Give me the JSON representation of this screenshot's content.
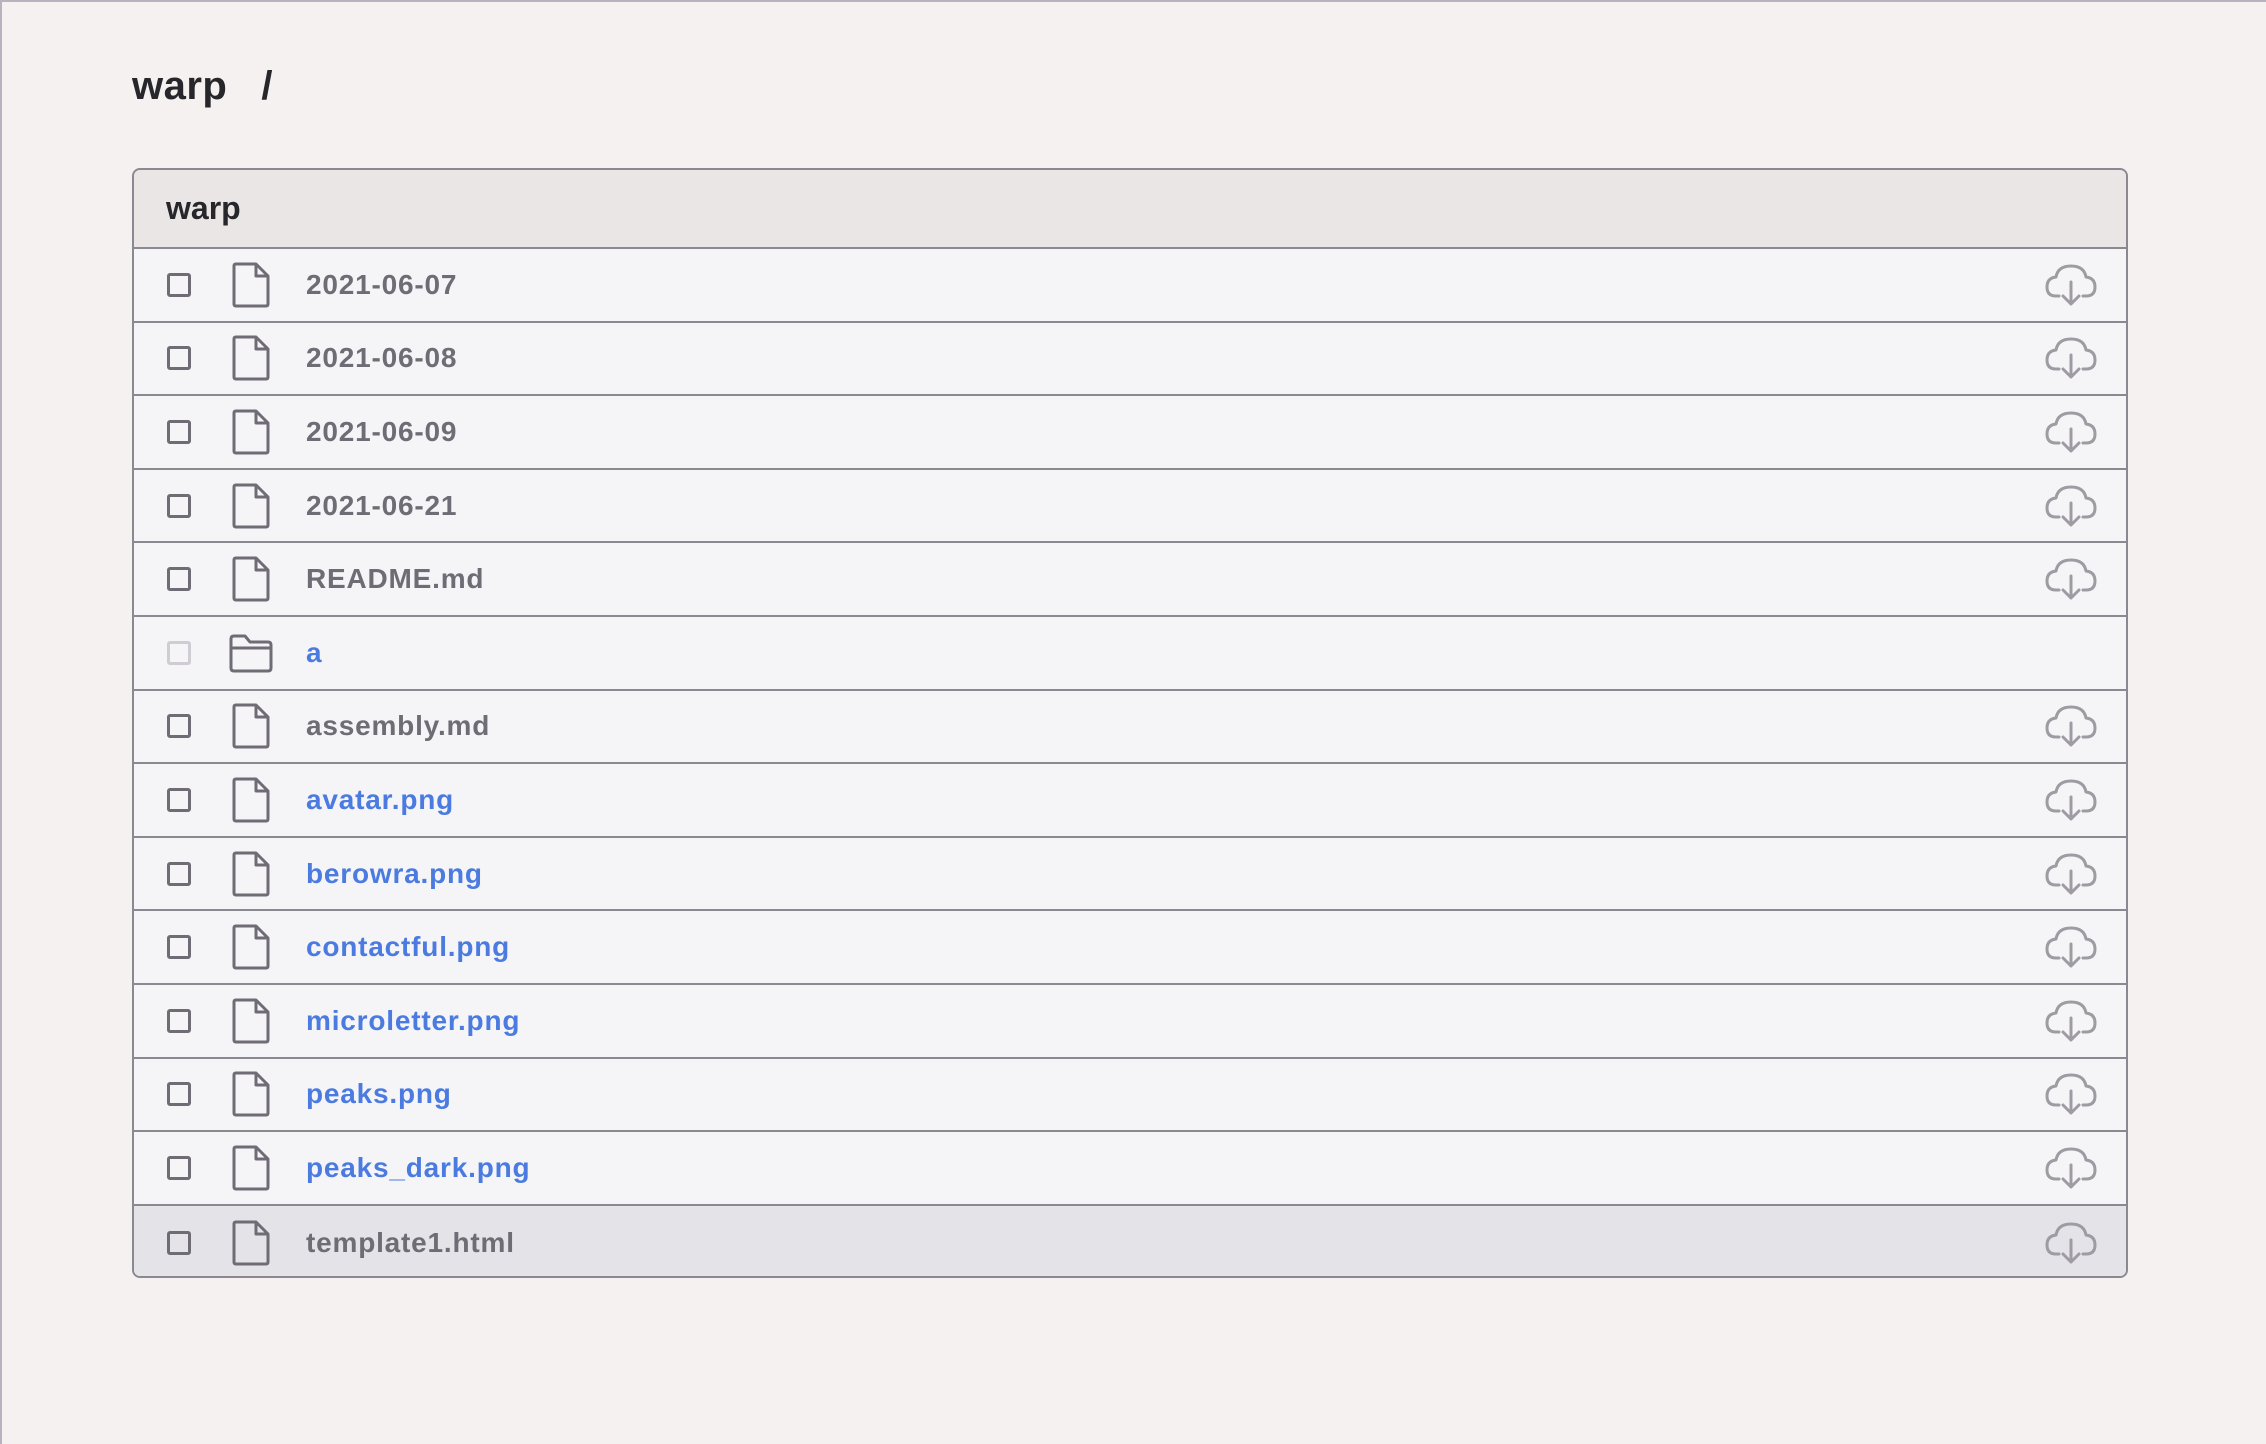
{
  "breadcrumb": {
    "root": "warp",
    "separator": "/"
  },
  "panel": {
    "title": "warp"
  },
  "colors": {
    "background": "#f4f1f0",
    "link": "#4b7be0",
    "text": "#6e6c74",
    "border": "#8b8892"
  },
  "files": [
    {
      "name": "2021-06-07",
      "type": "file",
      "link": false,
      "download": true
    },
    {
      "name": "2021-06-08",
      "type": "file",
      "link": false,
      "download": true
    },
    {
      "name": "2021-06-09",
      "type": "file",
      "link": false,
      "download": true
    },
    {
      "name": "2021-06-21",
      "type": "file",
      "link": false,
      "download": true
    },
    {
      "name": "README.md",
      "type": "file",
      "link": false,
      "download": true
    },
    {
      "name": "a",
      "type": "folder",
      "link": true,
      "download": false
    },
    {
      "name": "assembly.md",
      "type": "file",
      "link": false,
      "download": true
    },
    {
      "name": "avatar.png",
      "type": "file",
      "link": true,
      "download": true
    },
    {
      "name": "berowra.png",
      "type": "file",
      "link": true,
      "download": true
    },
    {
      "name": "contactful.png",
      "type": "file",
      "link": true,
      "download": true
    },
    {
      "name": "microletter.png",
      "type": "file",
      "link": true,
      "download": true
    },
    {
      "name": "peaks.png",
      "type": "file",
      "link": true,
      "download": true
    },
    {
      "name": "peaks_dark.png",
      "type": "file",
      "link": true,
      "download": true
    },
    {
      "name": "template1.html",
      "type": "file",
      "link": false,
      "download": true
    }
  ]
}
